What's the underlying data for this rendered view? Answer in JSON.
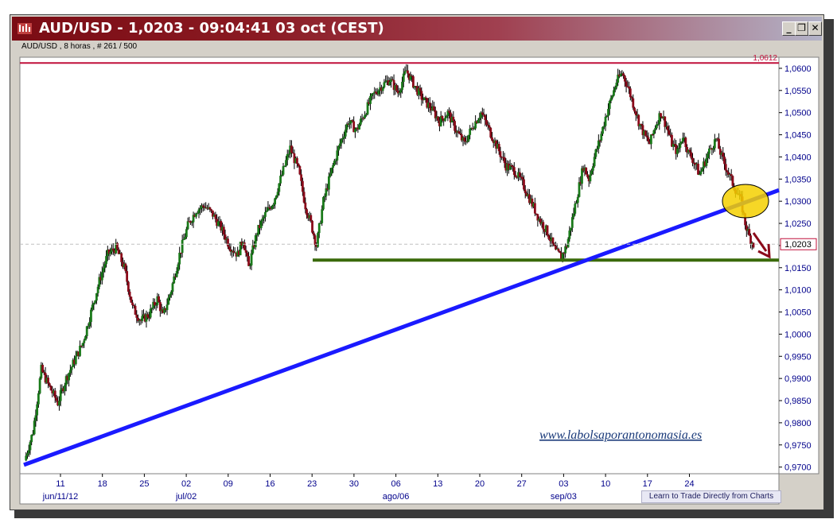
{
  "window": {
    "title": "AUD/USD - 1,0203 - 09:04:41  03 oct (CEST)",
    "subtitle": "AUD/USD , 8 horas , # 261 / 500",
    "buttons": {
      "minimize": "_",
      "restore": "❐",
      "close": "✕"
    }
  },
  "footer": {
    "learn_link": "Learn to Trade Directly from Charts"
  },
  "watermark": "www.labolsaporantonomasia.es",
  "colors": {
    "up": "#1a7a1a",
    "down": "#8b0a1a",
    "resistance": "#c0103a",
    "trend": "#1a1aff",
    "support": "#3a6a0a",
    "ellipse": "#f5d000",
    "arrow": "#8b0a1a",
    "axis_text": "#00008b"
  },
  "chart_data": {
    "type": "candlestick",
    "instrument": "AUD/USD",
    "timeframe": "8 horas",
    "last_price": "1,0203",
    "y_range": [
      0.9685,
      1.0625
    ],
    "y_ticks": [
      "1,0600",
      "1,0550",
      "1,0500",
      "1,0450",
      "1,0400",
      "1,0350",
      "1,0300",
      "1,0250",
      "1,0200",
      "1,0150",
      "1,0100",
      "1,0050",
      "1,0000",
      "0,9950",
      "0,9900",
      "0,9850",
      "0,9800",
      "0,9750",
      "0,9700"
    ],
    "y_tick_values": [
      1.06,
      1.055,
      1.05,
      1.045,
      1.04,
      1.035,
      1.03,
      1.025,
      1.02,
      1.015,
      1.01,
      1.005,
      1.0,
      0.995,
      0.99,
      0.985,
      0.98,
      0.975,
      0.97
    ],
    "x_day_labels": [
      "11",
      "18",
      "25",
      "02",
      "09",
      "16",
      "23",
      "30",
      "06",
      "13",
      "20",
      "27",
      "03",
      "10",
      "17",
      "24"
    ],
    "x_month_labels": [
      "jun/11/12",
      "jul/02",
      "ago/06",
      "sep/03"
    ],
    "resistance": {
      "level": 1.0612,
      "label": "1,0612"
    },
    "support": {
      "level": 1.0167
    },
    "trendline": {
      "from": 0.9705,
      "to": 1.0325
    },
    "current_label": "1,0203",
    "path_points": [
      [
        0,
        0.9715
      ],
      [
        6,
        0.978
      ],
      [
        12,
        0.992
      ],
      [
        18,
        0.988
      ],
      [
        24,
        0.9845
      ],
      [
        30,
        0.99
      ],
      [
        36,
        0.994
      ],
      [
        42,
        0.998
      ],
      [
        48,
        1.005
      ],
      [
        54,
        1.012
      ],
      [
        60,
        1.018
      ],
      [
        66,
        1.0195
      ],
      [
        72,
        1.015
      ],
      [
        78,
        1.006
      ],
      [
        84,
        1.003
      ],
      [
        90,
        1.0045
      ],
      [
        96,
        1.008
      ],
      [
        100,
        1.004
      ],
      [
        106,
        1.01
      ],
      [
        112,
        1.018
      ],
      [
        118,
        1.0245
      ],
      [
        124,
        1.028
      ],
      [
        130,
        1.029
      ],
      [
        136,
        1.027
      ],
      [
        142,
        1.024
      ],
      [
        148,
        1.02
      ],
      [
        154,
        1.018
      ],
      [
        158,
        1.0215
      ],
      [
        162,
        1.015
      ],
      [
        168,
        1.023
      ],
      [
        174,
        1.027
      ],
      [
        180,
        1.03
      ],
      [
        186,
        1.036
      ],
      [
        192,
        1.042
      ],
      [
        198,
        1.037
      ],
      [
        203,
        1.029
      ],
      [
        207,
        1.025
      ],
      [
        211,
        1.02
      ],
      [
        216,
        1.03
      ],
      [
        222,
        1.037
      ],
      [
        228,
        1.043
      ],
      [
        234,
        1.048
      ],
      [
        240,
        1.046
      ],
      [
        246,
        1.05
      ],
      [
        252,
        1.054
      ],
      [
        258,
        1.056
      ],
      [
        264,
        1.0575
      ],
      [
        270,
        1.0545
      ],
      [
        276,
        1.0595
      ],
      [
        282,
        1.056
      ],
      [
        288,
        1.053
      ],
      [
        294,
        1.051
      ],
      [
        300,
        1.048
      ],
      [
        306,
        1.05
      ],
      [
        312,
        1.046
      ],
      [
        318,
        1.043
      ],
      [
        324,
        1.047
      ],
      [
        330,
        1.05
      ],
      [
        336,
        1.046
      ],
      [
        342,
        1.042
      ],
      [
        348,
        1.038
      ],
      [
        354,
        1.037
      ],
      [
        360,
        1.034
      ],
      [
        366,
        1.03
      ],
      [
        372,
        1.026
      ],
      [
        378,
        1.023
      ],
      [
        384,
        1.0185
      ],
      [
        388,
        1.0175
      ],
      [
        392,
        1.02
      ],
      [
        396,
        1.026
      ],
      [
        400,
        1.032
      ],
      [
        404,
        1.038
      ],
      [
        408,
        1.035
      ],
      [
        412,
        1.04
      ],
      [
        416,
        1.044
      ],
      [
        420,
        1.049
      ],
      [
        424,
        1.053
      ],
      [
        428,
        1.057
      ],
      [
        432,
        1.059
      ],
      [
        436,
        1.056
      ],
      [
        440,
        1.052
      ],
      [
        444,
        1.048
      ],
      [
        448,
        1.045
      ],
      [
        452,
        1.043
      ],
      [
        456,
        1.047
      ],
      [
        460,
        1.05
      ],
      [
        464,
        1.047
      ],
      [
        468,
        1.043
      ],
      [
        472,
        1.041
      ],
      [
        476,
        1.045
      ],
      [
        480,
        1.041
      ],
      [
        484,
        1.039
      ],
      [
        488,
        1.036
      ],
      [
        492,
        1.039
      ],
      [
        496,
        1.042
      ],
      [
        500,
        1.044
      ],
      [
        504,
        1.04
      ],
      [
        508,
        1.037
      ],
      [
        512,
        1.034
      ],
      [
        515,
        1.032
      ],
      [
        518,
        1.03
      ],
      [
        521,
        1.025
      ],
      [
        524,
        1.022
      ],
      [
        527,
        1.0203
      ]
    ]
  }
}
